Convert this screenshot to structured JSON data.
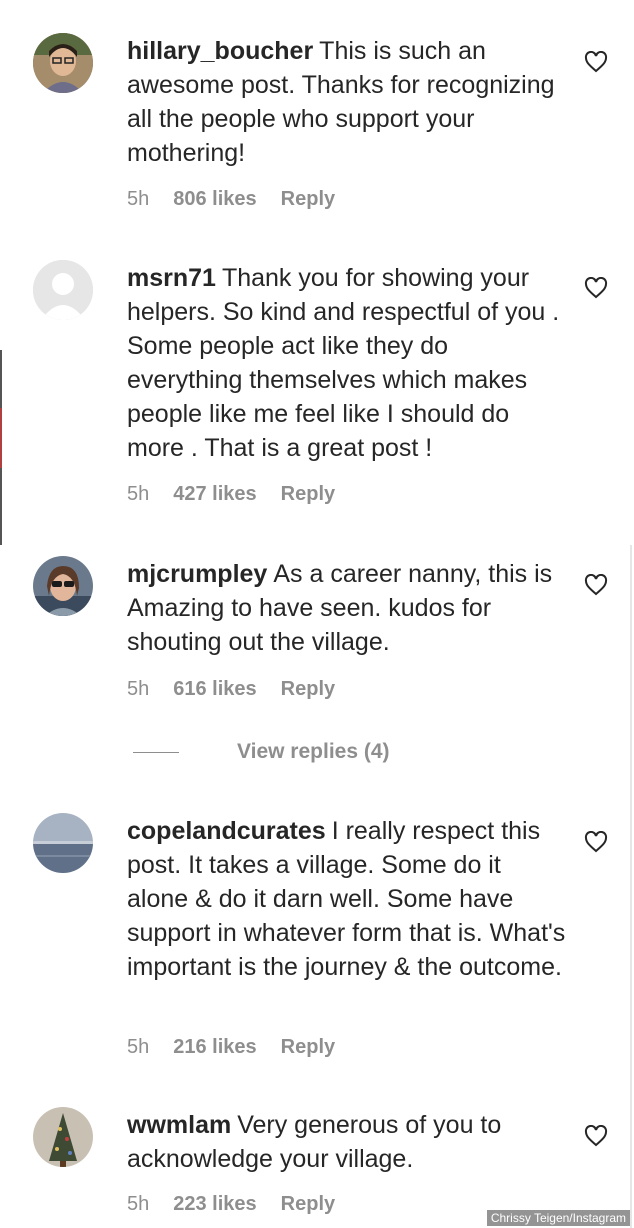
{
  "comments": [
    {
      "username": "hillary_boucher",
      "text": "This is such an awesome post. Thanks for recognizing all the people who support your mothering!",
      "time": "5h",
      "likes": "806 likes",
      "reply": "Reply",
      "avatar": "woman-with-glasses-photo"
    },
    {
      "username": "msrn71",
      "text": "Thank you for showing your helpers. So kind and respectful of you . Some people act like they do everything themselves which makes people like me feel like I should do more . That is a great post !",
      "time": "5h",
      "likes": "427 likes",
      "reply": "Reply",
      "avatar": "default-grey-avatar"
    },
    {
      "username": "mjcrumpley",
      "text": "As a career nanny, this is Amazing to have seen. kudos for shouting out the village.",
      "time": "5h",
      "likes": "616 likes",
      "reply": "Reply",
      "avatar": "woman-with-sunglasses-photo"
    },
    {
      "username": "copelandcurates",
      "text": "I really respect this post. It takes a village. Some do it alone & do it darn well. Some have support in whatever form that is. What's important is the journey & the outcome.",
      "time": "5h",
      "likes": "216 likes",
      "reply": "Reply",
      "avatar": "ocean-horizon-photo"
    },
    {
      "username": "wwmlam",
      "text": "Very generous of you to acknowledge your village.",
      "time": "5h",
      "likes": "223 likes",
      "reply": "Reply",
      "avatar": "christmas-tree-photo"
    }
  ],
  "view_replies": "View replies (4)",
  "caption": "Chrissy Teigen/Instagram",
  "colors": {
    "text": "#262626",
    "secondary": "#8e8e8e"
  }
}
